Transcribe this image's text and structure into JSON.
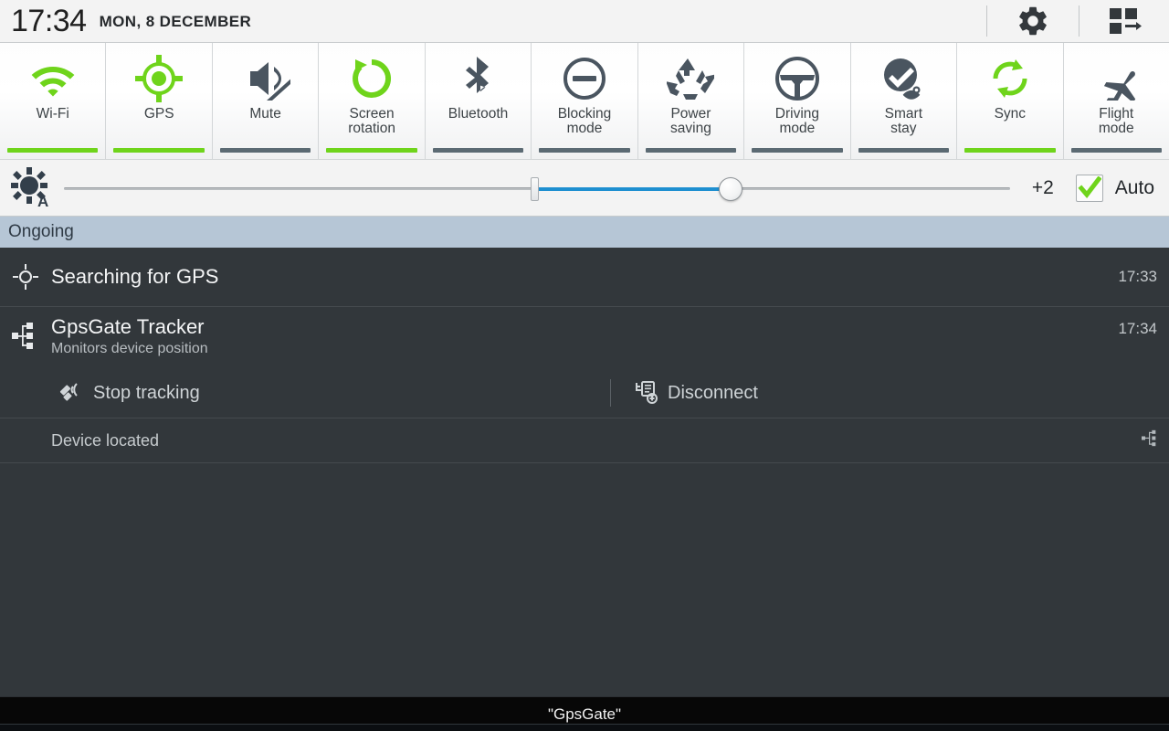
{
  "statusbar": {
    "time": "17:34",
    "date": "MON, 8 DECEMBER",
    "settings_icon": "gear-icon",
    "sort_icon": "quick-settings-grid-icon"
  },
  "quick_settings": {
    "tiles": [
      {
        "label": "Wi-Fi",
        "icon": "wifi-icon",
        "state": "on"
      },
      {
        "label": "GPS",
        "icon": "gps-location-icon",
        "state": "on"
      },
      {
        "label": "Mute",
        "icon": "mute-speaker-icon",
        "state": "off"
      },
      {
        "label": "Screen\nrotation",
        "icon": "screen-rotation-icon",
        "state": "on"
      },
      {
        "label": "Bluetooth",
        "icon": "bluetooth-icon",
        "state": "off"
      },
      {
        "label": "Blocking\nmode",
        "icon": "blocking-mode-icon",
        "state": "off"
      },
      {
        "label": "Power\nsaving",
        "icon": "power-saving-icon",
        "state": "off"
      },
      {
        "label": "Driving\nmode",
        "icon": "driving-mode-icon",
        "state": "off"
      },
      {
        "label": "Smart\nstay",
        "icon": "smart-stay-icon",
        "state": "off"
      },
      {
        "label": "Sync",
        "icon": "sync-icon",
        "state": "on"
      },
      {
        "label": "Flight\nmode",
        "icon": "airplane-icon",
        "state": "off"
      }
    ],
    "colors": {
      "on": "#6fd41b",
      "off": "#5b6a73"
    }
  },
  "brightness": {
    "icon": "brightness-auto-icon",
    "value_label": "+2",
    "auto_label": "Auto",
    "auto_checked": true,
    "slider_fill_color": "#1e8fd0",
    "tick_position_pct": 50,
    "thumb_position_pct": 70
  },
  "notifications": {
    "section_header": "Ongoing",
    "items": [
      {
        "icon": "gps-searching-icon",
        "title": "Searching for GPS",
        "subtitle": "",
        "time": "17:33"
      },
      {
        "icon": "gpsgate-tracker-icon",
        "title": "GpsGate Tracker",
        "subtitle": "Monitors device position",
        "time": "17:34"
      }
    ],
    "actions": [
      {
        "icon": "satellite-off-icon",
        "label": "Stop tracking"
      },
      {
        "icon": "disconnect-icon",
        "label": "Disconnect"
      }
    ],
    "status": {
      "text": "Device located",
      "icon": "gpsgate-small-icon"
    }
  },
  "toast": {
    "text": "\"GpsGate\""
  }
}
